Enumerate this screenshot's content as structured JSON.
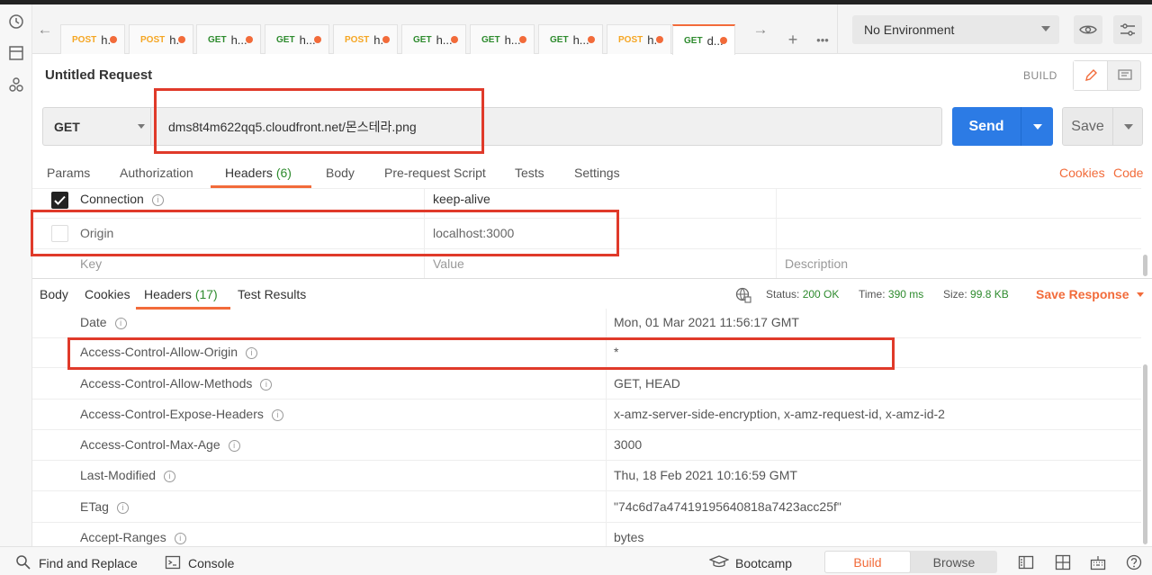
{
  "request_tabs": [
    {
      "method": "POST",
      "title": "h."
    },
    {
      "method": "POST",
      "title": "h."
    },
    {
      "method": "GET",
      "title": "h..."
    },
    {
      "method": "GET",
      "title": "h..."
    },
    {
      "method": "POST",
      "title": "h."
    },
    {
      "method": "GET",
      "title": "h..."
    },
    {
      "method": "GET",
      "title": "h..."
    },
    {
      "method": "GET",
      "title": "h..."
    },
    {
      "method": "POST",
      "title": "h."
    },
    {
      "method": "GET",
      "title": "d..."
    }
  ],
  "environment": {
    "selected": "No Environment"
  },
  "request": {
    "title": "Untitled Request",
    "mode_label": "BUILD",
    "method": "GET",
    "url": "dms8t4m622qq5.cloudfront.net/몬스테라.png",
    "send_label": "Send",
    "save_label": "Save"
  },
  "request_subtabs": {
    "params": "Params",
    "authorization": "Authorization",
    "headers": "Headers",
    "headers_count": "(6)",
    "body": "Body",
    "pre_request": "Pre-request Script",
    "tests": "Tests",
    "settings": "Settings",
    "cookies_link": "Cookies",
    "code_link": "Code"
  },
  "request_headers": [
    {
      "key": "Connection",
      "value": "keep-alive",
      "enabled": true
    },
    {
      "key": "Origin",
      "value": "localhost:3000",
      "enabled": false
    }
  ],
  "request_headers_placeholder": {
    "key": "Key",
    "value": "Value",
    "description": "Description"
  },
  "response_tabs": {
    "body": "Body",
    "cookies": "Cookies",
    "headers": "Headers",
    "headers_count": "(17)",
    "test_results": "Test Results"
  },
  "response_status": {
    "status_label": "Status:",
    "status": "200 OK",
    "time_label": "Time:",
    "time": "390 ms",
    "size_label": "Size:",
    "size": "99.8 KB",
    "save_response": "Save Response"
  },
  "response_headers": [
    {
      "key": "Date",
      "value": "Mon, 01 Mar 2021 11:56:17 GMT"
    },
    {
      "key": "Access-Control-Allow-Origin",
      "value": "*"
    },
    {
      "key": "Access-Control-Allow-Methods",
      "value": "GET, HEAD"
    },
    {
      "key": "Access-Control-Expose-Headers",
      "value": "x-amz-server-side-encryption, x-amz-request-id, x-amz-id-2"
    },
    {
      "key": "Access-Control-Max-Age",
      "value": "3000"
    },
    {
      "key": "Last-Modified",
      "value": "Thu, 18 Feb 2021 10:16:59 GMT"
    },
    {
      "key": "ETag",
      "value": "\"74c6d7a47419195640818a7423acc25f\""
    },
    {
      "key": "Accept-Ranges",
      "value": "bytes"
    }
  ],
  "bottom_bar": {
    "find_replace": "Find and Replace",
    "console": "Console",
    "bootcamp": "Bootcamp",
    "build": "Build",
    "browse": "Browse"
  },
  "info_glyph": "i",
  "colors": {
    "accent": "#f26b3a",
    "send": "#2c7be5",
    "success": "#2e8b2e",
    "annotation": "#e03a2a"
  }
}
